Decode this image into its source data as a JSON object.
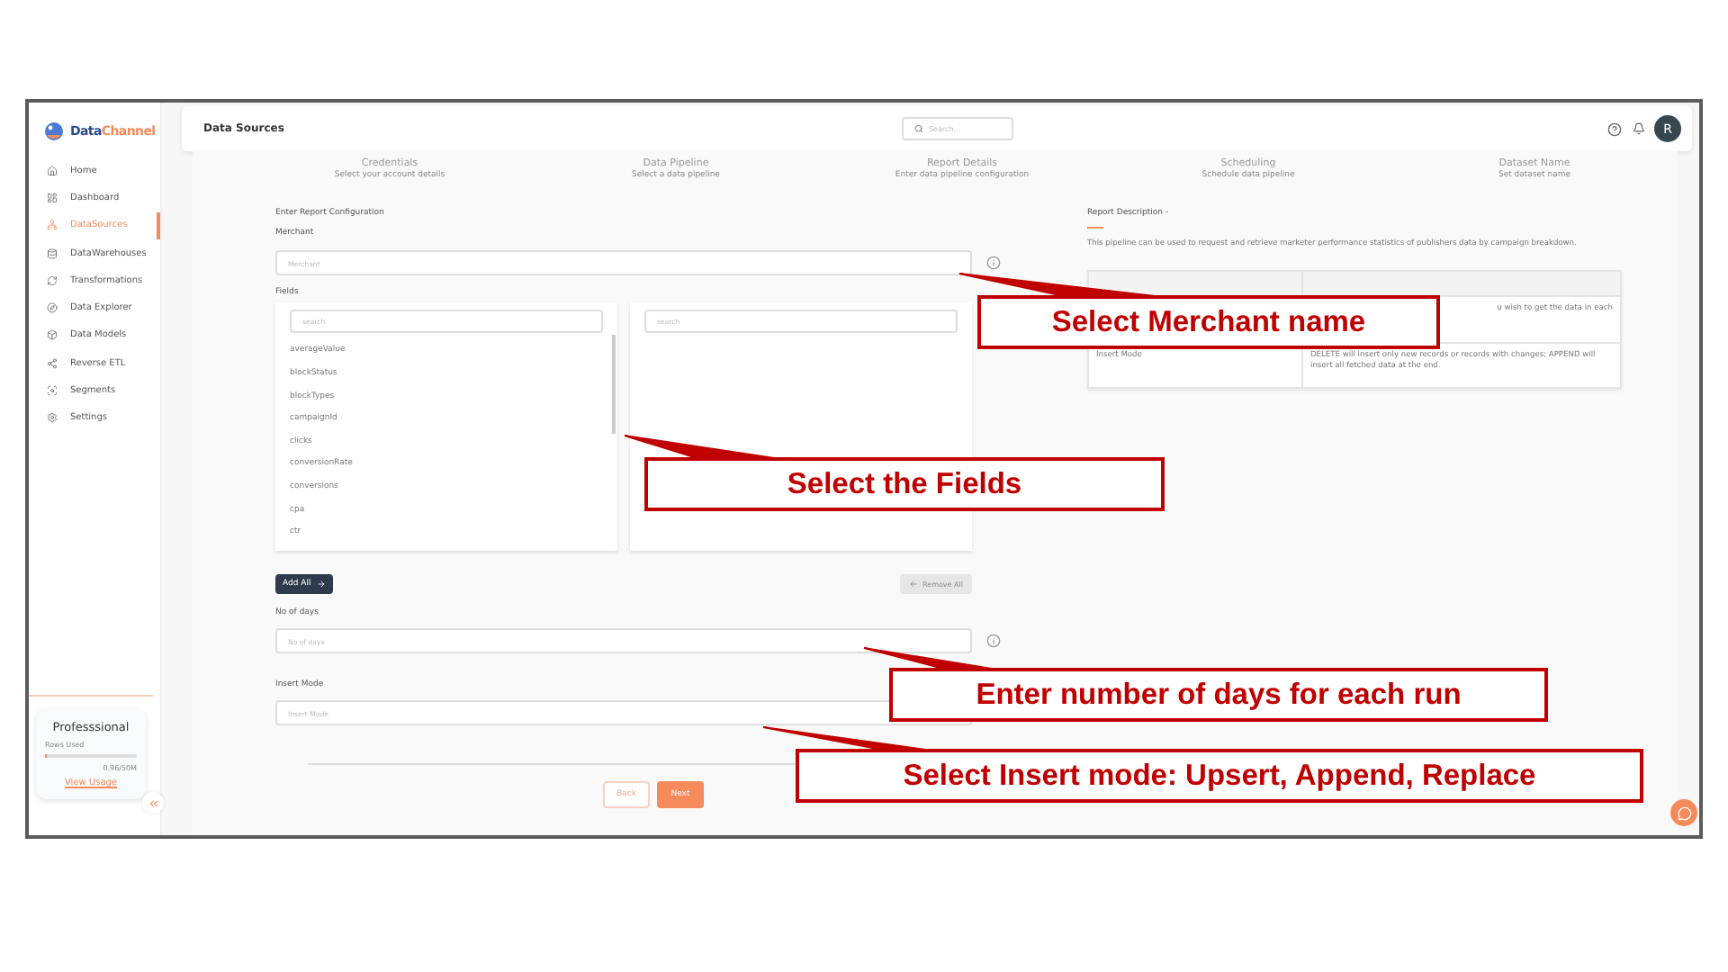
{
  "sidebar": {
    "logo": {
      "part_1": "Data",
      "part_2": "Channel"
    },
    "items": [
      {
        "label": "Home",
        "selected": false
      },
      {
        "label": "Dashboard",
        "selected": false
      },
      {
        "label": "DataSources",
        "selected": true
      },
      {
        "label": "DataWarehouses",
        "selected": false
      },
      {
        "label": "Transformations",
        "selected": false
      },
      {
        "label": "Data Explorer",
        "selected": false
      },
      {
        "label": "Data Models",
        "selected": false
      },
      {
        "label": "Reverse ETL",
        "selected": false
      },
      {
        "label": "Segments",
        "selected": false
      },
      {
        "label": "Settings",
        "selected": false
      }
    ],
    "plan": {
      "name": "Professsional",
      "usage_label": "Rows Used",
      "level": 0.02,
      "usage": "0.96/50M",
      "link": "View Usage"
    }
  },
  "header": {
    "title": "Data Sources",
    "search": {
      "placeholder": "Search..."
    },
    "avatar": "R"
  },
  "steps": [
    {
      "title": "Credentials",
      "subtitle": "Select your account details"
    },
    {
      "title": "Data Pipeline",
      "subtitle": "Select a data pipeline"
    },
    {
      "title": "Report Details",
      "subtitle": "Enter data pipeline configuration"
    },
    {
      "title": "Scheduling",
      "subtitle": "Schedule data pipeline"
    },
    {
      "title": "Dataset Name",
      "subtitle": "Set dataset name"
    }
  ],
  "form": {
    "heading": "Enter Report Configuration",
    "merchant": {
      "label": "Merchant",
      "placeholder": "Merchant"
    },
    "fields": {
      "label": "Fields",
      "available_search": {
        "placeholder": "search"
      },
      "selected_search": {
        "placeholder": "search"
      },
      "available": [
        "averageValue",
        "blockStatus",
        "blockTypes",
        "campaignId",
        "clicks",
        "conversionRate",
        "conversions",
        "cpa",
        "ctr"
      ],
      "add_all": "Add All",
      "remove_all": {
        "label": "Remove All",
        "disabled": true
      }
    },
    "days": {
      "label": "No of days",
      "placeholder": "No of days"
    },
    "insert_mode": {
      "label": "Insert Mode",
      "placeholder": "Insert Mode"
    },
    "back": "Back",
    "next": "Next"
  },
  "description": {
    "title": "Report Description -",
    "text": "This pipeline can be used to request and retrieve marketer performance statistics of publishers data by campaign breakdown.",
    "rows": [
      {
        "column_1": "",
        "column_2": "u wish to get the data in each"
      },
      {
        "column_1": "Insert Mode",
        "column_2": "DELETE will insert only new records or records with changes; APPEND will insert all fetched data at the end."
      }
    ]
  },
  "annotations": [
    {
      "text": "Select Merchant name"
    },
    {
      "text": "Select the Fields"
    },
    {
      "text": "Enter number of days for each run"
    },
    {
      "text": "Select Insert mode: Upsert, Append, Replace"
    }
  ]
}
